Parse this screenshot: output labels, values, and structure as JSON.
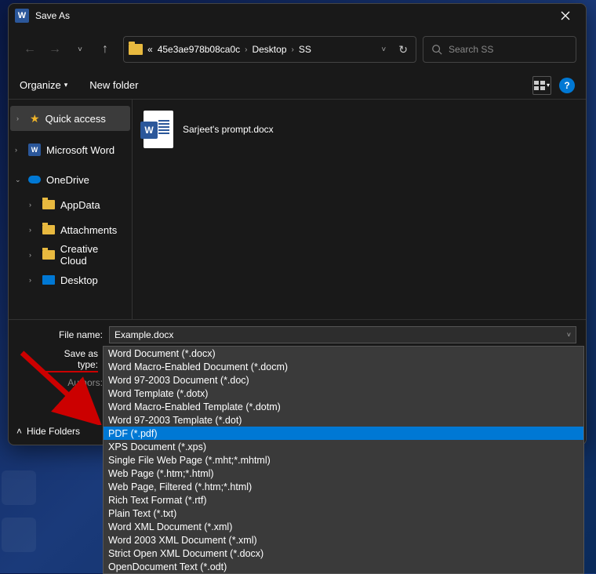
{
  "title": "Save As",
  "nav": {
    "path_prefix": "«",
    "crumb1": "45e3ae978b08ca0c",
    "crumb2": "Desktop",
    "crumb3": "SS",
    "search_placeholder": "Search SS"
  },
  "toolbar": {
    "organize": "Organize",
    "new_folder": "New folder"
  },
  "sidebar": {
    "quick_access": "Quick access",
    "ms_word": "Microsoft Word",
    "onedrive": "OneDrive",
    "appdata": "AppData",
    "attachments": "Attachments",
    "creative_cloud": "Creative Cloud",
    "desktop": "Desktop"
  },
  "file": {
    "name": "Sarjeet's prompt.docx"
  },
  "bottom": {
    "filename_label": "File name:",
    "filename_value": "Example.docx",
    "savetype_label": "Save as type:",
    "savetype_value": "Word Document (*.docx)",
    "authors_label": "Authors:",
    "hide_folders": "Hide Folders"
  },
  "types": [
    "Word Document (*.docx)",
    "Word Macro-Enabled Document (*.docm)",
    "Word 97-2003 Document (*.doc)",
    "Word Template (*.dotx)",
    "Word Macro-Enabled Template (*.dotm)",
    "Word 97-2003 Template (*.dot)",
    "PDF (*.pdf)",
    "XPS Document (*.xps)",
    "Single File Web Page (*.mht;*.mhtml)",
    "Web Page (*.htm;*.html)",
    "Web Page, Filtered (*.htm;*.html)",
    "Rich Text Format (*.rtf)",
    "Plain Text (*.txt)",
    "Word XML Document (*.xml)",
    "Word 2003 XML Document (*.xml)",
    "Strict Open XML Document (*.docx)",
    "OpenDocument Text (*.odt)"
  ],
  "types_selected_index": 6
}
